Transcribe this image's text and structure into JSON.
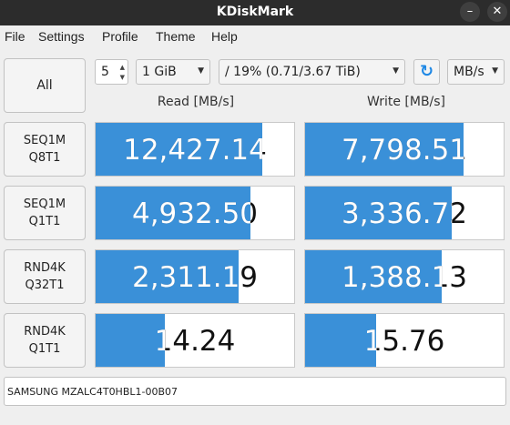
{
  "window": {
    "title": "KDiskMark",
    "minimize_icon": "minimize-icon",
    "close_icon": "close-icon"
  },
  "menu": [
    "File",
    "Settings",
    "Profile",
    "Theme",
    "Help"
  ],
  "controls": {
    "all_label": "All",
    "runs": "5",
    "size": "1 GiB",
    "target": "/ 19% (0.71/3.67 TiB)",
    "unit": "MB/s"
  },
  "headers": {
    "read": "Read [MB/s]",
    "write": "Write [MB/s]"
  },
  "rows": [
    {
      "line1": "SEQ1M",
      "line2": "Q8T1",
      "read": "12,427.14",
      "write": "7,798.51",
      "read_fill": 0.84,
      "write_fill": 0.8
    },
    {
      "line1": "SEQ1M",
      "line2": "Q1T1",
      "read": "4,932.50",
      "write": "3,336.72",
      "read_fill": 0.78,
      "write_fill": 0.74
    },
    {
      "line1": "RND4K",
      "line2": "Q32T1",
      "read": "2,311.19",
      "write": "1,388.13",
      "read_fill": 0.72,
      "write_fill": 0.69
    },
    {
      "line1": "RND4K",
      "line2": "Q1T1",
      "read": "14.24",
      "write": "15.76",
      "read_fill": 0.35,
      "write_fill": 0.36
    }
  ],
  "device": "SAMSUNG MZALC4T0HBL1-00B07",
  "colors": {
    "bar": "#3a90d8",
    "titlebar": "#2c2c2c",
    "refresh": "#1e88e5"
  }
}
